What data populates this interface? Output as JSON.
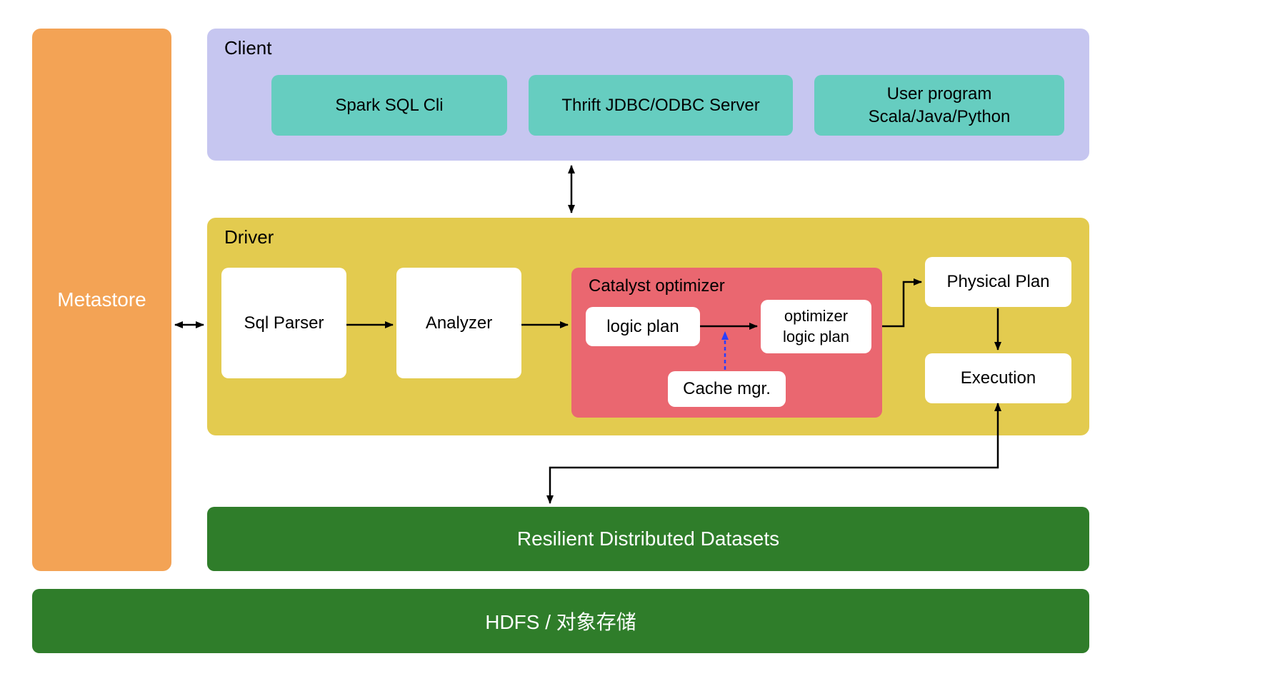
{
  "metastore": {
    "label": "Metastore"
  },
  "client": {
    "title": "Client",
    "items": [
      {
        "label": "Spark SQL Cli"
      },
      {
        "label": "Thrift JDBC/ODBC Server"
      },
      {
        "line1": "User program",
        "line2": "Scala/Java/Python"
      }
    ]
  },
  "driver": {
    "title": "Driver",
    "sql_parser": "Sql Parser",
    "analyzer": "Analyzer",
    "catalyst": {
      "title": "Catalyst optimizer",
      "logic_plan": "logic plan",
      "optimizer_line1": "optimizer",
      "optimizer_line2": "logic plan",
      "cache_mgr": "Cache mgr."
    },
    "physical_plan": "Physical Plan",
    "execution": "Execution"
  },
  "rdd": {
    "label": "Resilient Distributed Datasets"
  },
  "hdfs": {
    "label": "HDFS / 对象存储"
  }
}
